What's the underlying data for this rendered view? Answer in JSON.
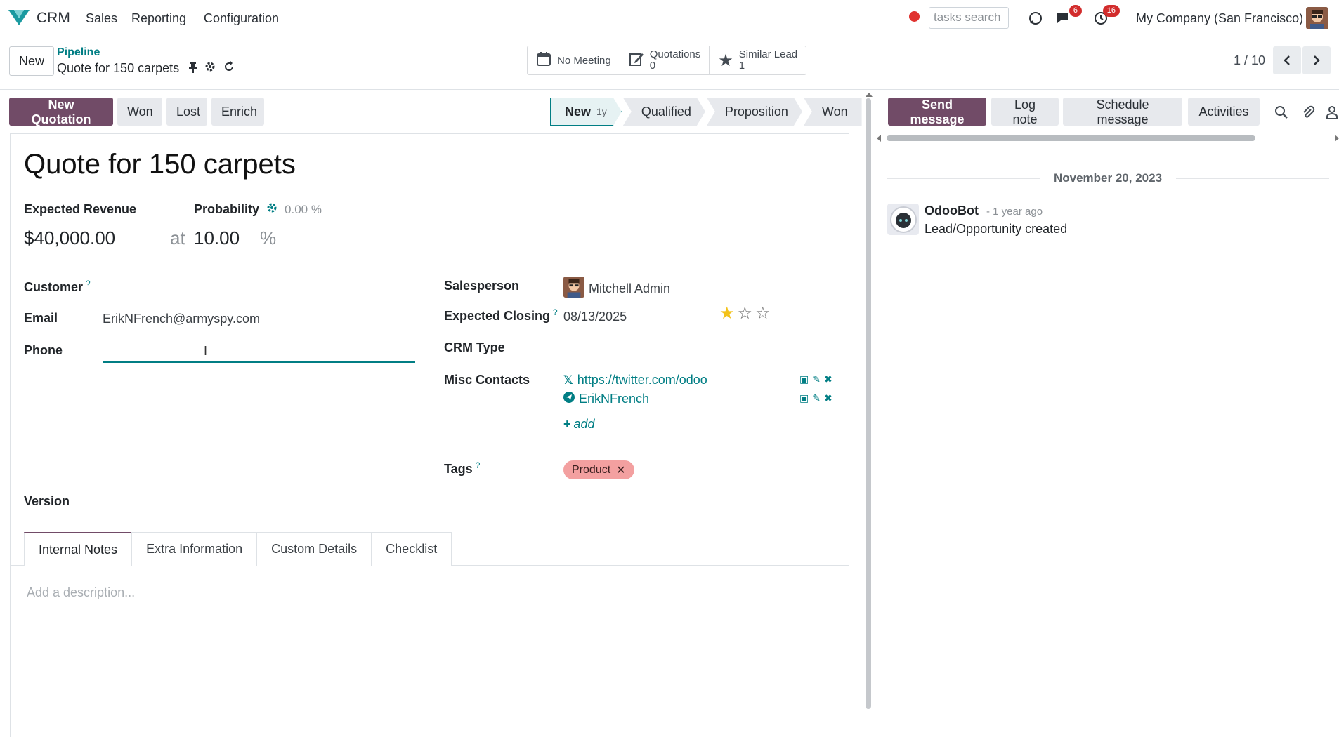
{
  "navbar": {
    "brand": "CRM",
    "menu": [
      "Sales",
      "Reporting",
      "Configuration"
    ],
    "search_value": "tasks search",
    "messages_badge": "6",
    "activities_badge": "16",
    "company": "My Company (San Francisco)"
  },
  "control_panel": {
    "new_button": "New",
    "breadcrumb_parent": "Pipeline",
    "breadcrumb_current": "Quote for 150 carpets",
    "stat_buttons": {
      "meeting": "No Meeting",
      "quotations_label": "Quotations",
      "quotations_count": "0",
      "similar_label": "Similar Lead",
      "similar_count": "1"
    },
    "pager": "1 / 10"
  },
  "statusbar": {
    "actions": [
      "New Quotation",
      "Won",
      "Lost",
      "Enrich"
    ],
    "stages": [
      {
        "label": "New",
        "badge": "1y"
      },
      {
        "label": "Qualified"
      },
      {
        "label": "Proposition"
      },
      {
        "label": "Won"
      }
    ]
  },
  "form": {
    "title": "Quote for 150 carpets",
    "expected_revenue_label": "Expected Revenue",
    "expected_revenue": "$40,000.00",
    "at": "at",
    "probability_label": "Probability",
    "probability_auto": "0.00 %",
    "probability": "10.00",
    "percent": "%",
    "customer_label": "Customer",
    "email_label": "Email",
    "email": "ErikNFrench@armyspy.com",
    "phone_label": "Phone",
    "phone": "",
    "salesperson_label": "Salesperson",
    "salesperson": "Mitchell Admin",
    "closing_label": "Expected Closing",
    "closing": "08/13/2025",
    "priority_stars": 1,
    "crm_type_label": "CRM Type",
    "misc_contacts_label": "Misc Contacts",
    "misc_contacts": [
      "https://twitter.com/odoo",
      "ErikNFrench"
    ],
    "add_label": "add",
    "tags_label": "Tags",
    "tags": [
      "Product"
    ],
    "version_label": "Version",
    "help_mark": "?"
  },
  "tabs": [
    "Internal Notes",
    "Extra Information",
    "Custom Details",
    "Checklist"
  ],
  "description_placeholder": "Add a description...",
  "chatter": {
    "buttons": [
      "Send message",
      "Log note",
      "Schedule message",
      "Activities"
    ],
    "date_separator": "November 20, 2023",
    "message": {
      "author": "OdooBot",
      "time": "- 1 year ago",
      "body": "Lead/Opportunity created"
    }
  },
  "colors": {
    "primary": "#714b67",
    "accent": "#017e84",
    "tag_product": "#f3a0a0",
    "badge": "#d22c2c"
  }
}
